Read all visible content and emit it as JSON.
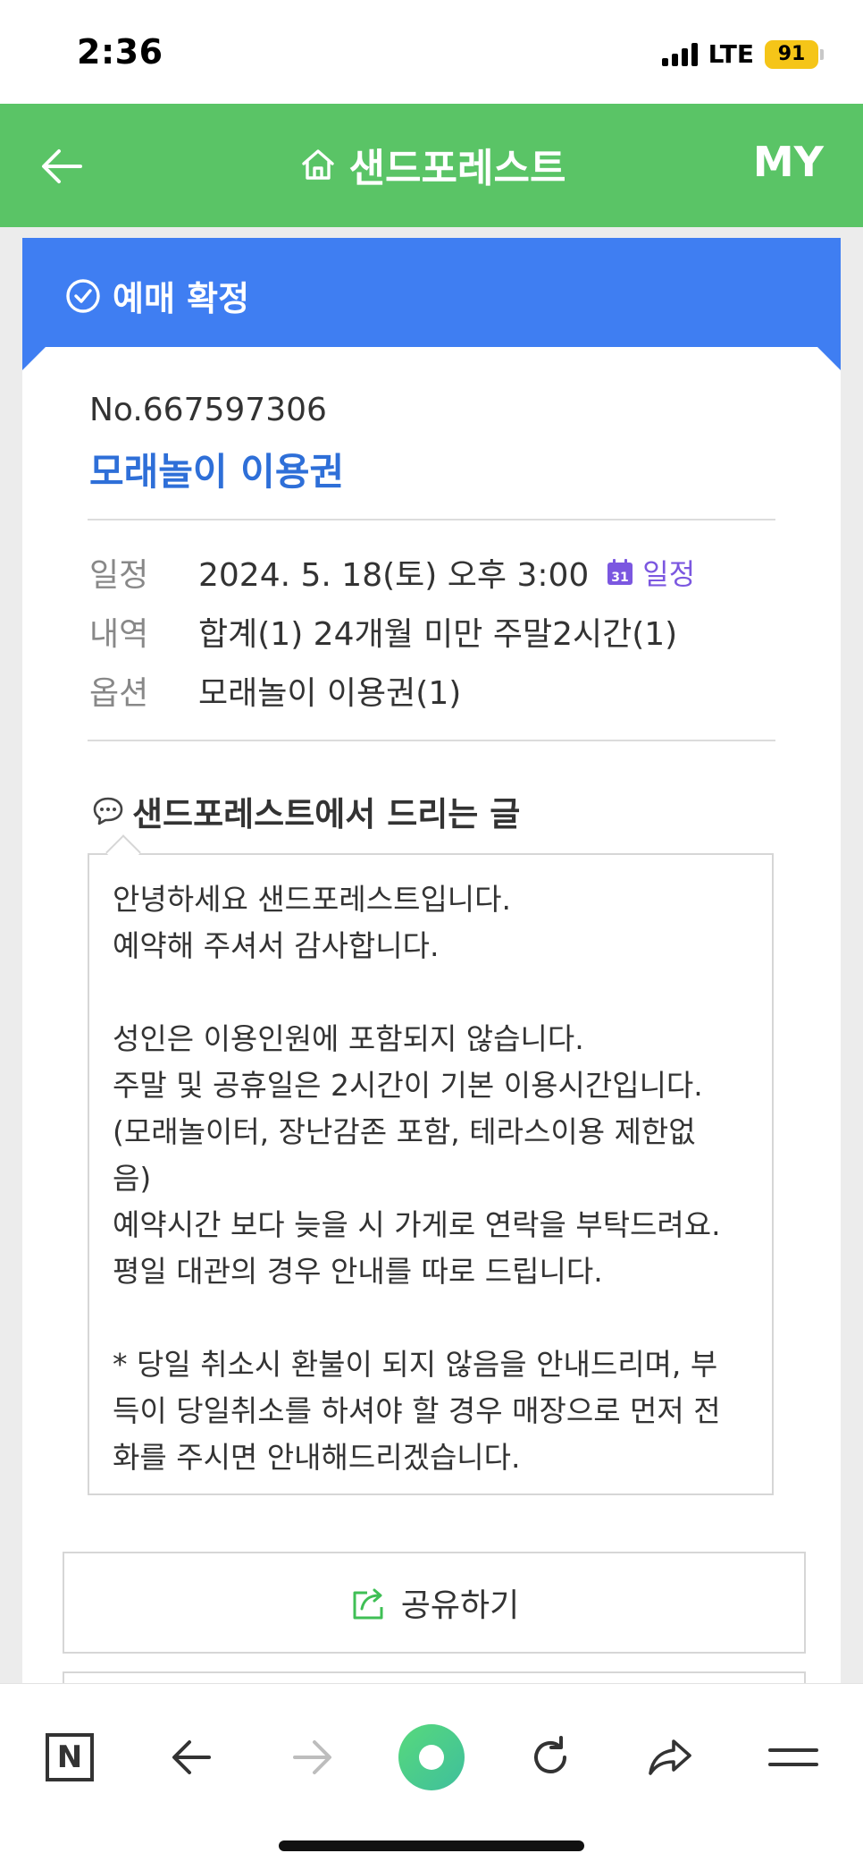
{
  "status_bar": {
    "time": "2:36",
    "network": "LTE",
    "battery": "91"
  },
  "header": {
    "back_icon": "arrow-left-icon",
    "home_icon": "home-icon",
    "title": "샌드포레스트",
    "my_label": "MY"
  },
  "confirmation": {
    "icon": "check-circle-icon",
    "label": "예매 확정"
  },
  "booking": {
    "number": "No.667597306",
    "product": "모래놀이 이용권",
    "rows": [
      {
        "label": "일정",
        "value": "2024. 5. 18(토) 오후 3:00"
      },
      {
        "label": "내역",
        "value": "합계(1) 24개월 미만 주말2시간(1)"
      },
      {
        "label": "옵션",
        "value": "모래놀이 이용권(1)"
      }
    ],
    "calendar_link": {
      "icon": "calendar-31-icon",
      "label": "일정"
    }
  },
  "message": {
    "heading_icon": "speech-bubble-icon",
    "heading": "샌드포레스트에서 드리는 글",
    "lines": [
      "안녕하세요 샌드포레스트입니다.",
      "예약해 주셔서 감사합니다.",
      "",
      "성인은 이용인원에 포함되지 않습니다.",
      "주말 및 공휴일은 2시간이 기본 이용시간입니다.",
      "(모래놀이터, 장난감존 포함, 테라스이용 제한없",
      "음)",
      "예약시간 보다 늦을 시 가게로 연락을 부탁드려요.",
      "평일 대관의 경우 안내를 따로 드립니다.",
      "",
      "* 당일 취소시 환불이 되지 않음을 안내드리며, 부",
      "득이 당일취소를 하셔야 할 경우 매장으로 먼저 전",
      "화를 주시면 안내해드리겠습니다."
    ]
  },
  "actions": {
    "share_icon": "share-icon",
    "share_label": "공유하기"
  },
  "toolbar": {
    "items": [
      "naver-n-icon",
      "back-arrow-icon",
      "forward-arrow-icon",
      "green-home-dot-icon",
      "refresh-icon",
      "share-arrow-icon",
      "menu-icon"
    ]
  },
  "colors": {
    "header_green": "#5ac466",
    "confirm_blue": "#3f7ef2",
    "product_blue": "#2e6fd8",
    "calendar_purple": "#7b57e0",
    "battery_yellow": "#f5c518"
  }
}
